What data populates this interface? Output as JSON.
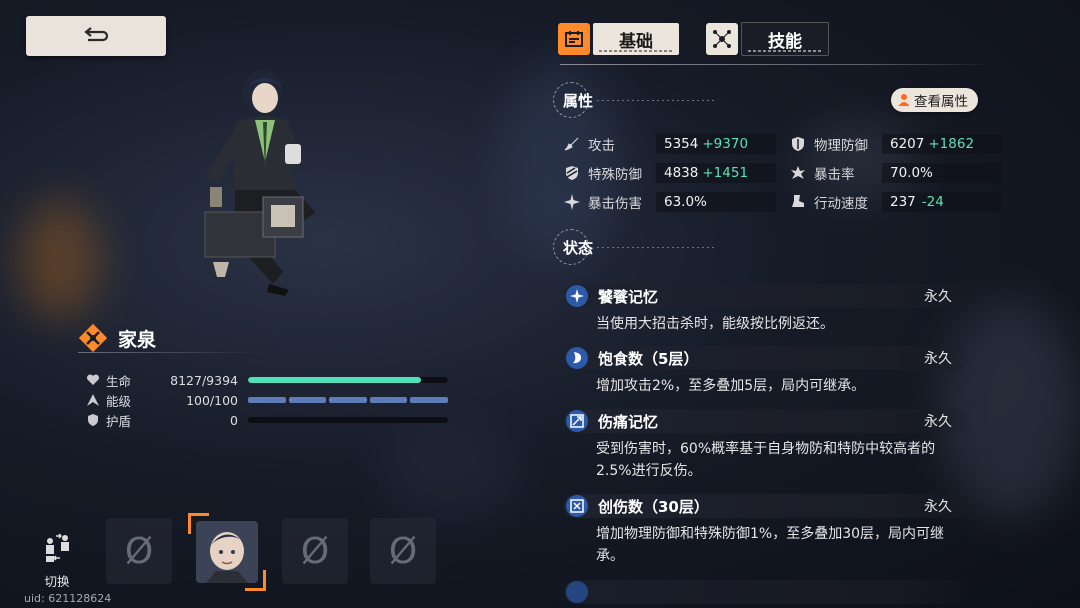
{
  "uid": "uid: 621128624",
  "character": {
    "name": "家泉",
    "stats": [
      {
        "label": "生命",
        "value": "8127/9394",
        "fill": 0.865
      },
      {
        "label": "能级",
        "value": "100/100",
        "fill": 1.0
      },
      {
        "label": "护盾",
        "value": "0",
        "fill": 0
      }
    ]
  },
  "switch_label": "切换",
  "empty_slot_symbol": "Ø",
  "tabs": [
    {
      "label": "基础",
      "active": true
    },
    {
      "label": "技能",
      "active": false
    }
  ],
  "attributes_section": {
    "title": "属性",
    "view_button": "查看属性",
    "items": [
      {
        "label": "攻击",
        "base": "5354",
        "bonus": "+9370",
        "icon": "sword-icon"
      },
      {
        "label": "物理防御",
        "base": "6207",
        "bonus": "+1862",
        "icon": "shield-icon"
      },
      {
        "label": "特殊防御",
        "base": "4838",
        "bonus": "+1451",
        "icon": "stripes-shield-icon"
      },
      {
        "label": "暴击率",
        "base": "70.0%",
        "bonus": "",
        "icon": "burst-icon"
      },
      {
        "label": "暴击伤害",
        "base": "63.0%",
        "bonus": "",
        "icon": "star-burst-icon"
      },
      {
        "label": "行动速度",
        "base": "237",
        "bonus": "-24",
        "icon": "boot-icon"
      }
    ]
  },
  "status_section": {
    "title": "状态",
    "items": [
      {
        "name": "饕餮记忆",
        "duration": "永久",
        "desc": "当使用大招击杀时，能级按比例返还。"
      },
      {
        "name": "饱食数（5层）",
        "duration": "永久",
        "desc": "增加攻击2%，至多叠加5层，局内可继承。"
      },
      {
        "name": "伤痛记忆",
        "duration": "永久",
        "desc": "受到伤害时，60%概率基于自身物防和特防中较高者的2.5%进行反伤。"
      },
      {
        "name": "创伤数（30层）",
        "duration": "永久",
        "desc": "增加物理防御和特殊防御1%，至多叠加30层，局内可继承。"
      }
    ]
  },
  "colors": {
    "accent": "#ff8a2a",
    "hp": "#52e0b9",
    "energy": "#5e7cb8",
    "bonus": "#5fe0b1"
  }
}
